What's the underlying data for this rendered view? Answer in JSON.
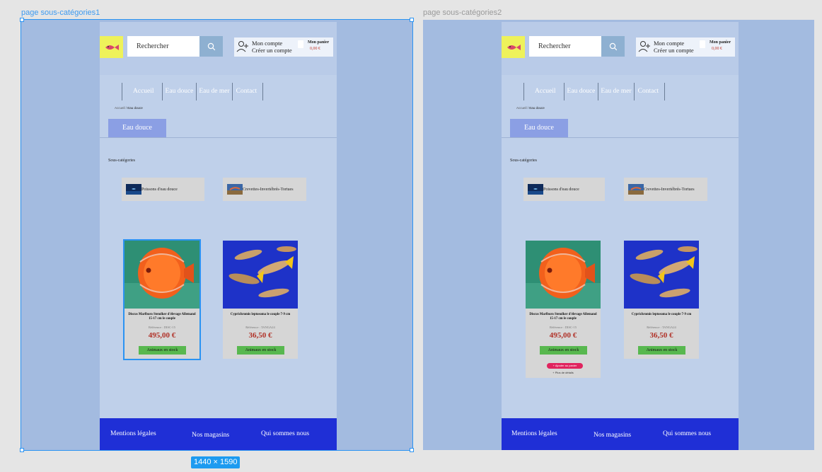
{
  "canvas": {
    "frames": [
      {
        "label": "page sous-catégories1"
      },
      {
        "label": "page sous-catégories2"
      }
    ],
    "size_badge": "1440 × 1590",
    "selection_color": "#2b93f2"
  },
  "site": {
    "search": {
      "placeholder": "Rechercher"
    },
    "account": {
      "line1": "Mon compte",
      "line2": "Créer un compte"
    },
    "cart": {
      "title": "Mon panier",
      "amount": "0,00 €"
    },
    "nav": [
      "Accueil",
      "Eau douce",
      "Eau de mer",
      "Contact"
    ],
    "breadcrumb": {
      "home": "Accueil",
      "separator": " / ",
      "current": "Eau douce"
    },
    "category_tab": "Eau douce",
    "subcategories_title": "Sous-catégories",
    "subcategories": [
      {
        "label": "Poissons d'eau douce",
        "icon": "fish-thumbnail"
      },
      {
        "label": "Crevettes-Invertébrés-Tortues",
        "icon": "shrimp-thumbnail"
      }
    ],
    "products": [
      {
        "name": "Discus Marlboro Stendker d'élevage Allemand 15-17 cm le couple",
        "reference": "Référence : DISC-15",
        "price": "495,00 €",
        "stock": "Animaux en stock"
      },
      {
        "name": "Cyprichromis leptosoma le couple 7-9 cm",
        "reference": "Référence : TANGA24",
        "price": "36,50 €",
        "stock": "Animaux en stock"
      }
    ],
    "hover_actions": {
      "add_to_cart": "+ Ajouter au panier",
      "more_details": "+ Plus de détails"
    },
    "footer": [
      "Mentions légales",
      "Nos magasins",
      "Qui sommes nous"
    ],
    "colors": {
      "outer_background": "#a3bbe0",
      "page_background": "#bfd0ea",
      "logo_background": "#eef25a",
      "category_tab": "#8b9fe4",
      "price": "#b03026",
      "stock": "#58b84f",
      "add_to_cart": "#e0245e",
      "footer": "#1f2fd6"
    }
  }
}
